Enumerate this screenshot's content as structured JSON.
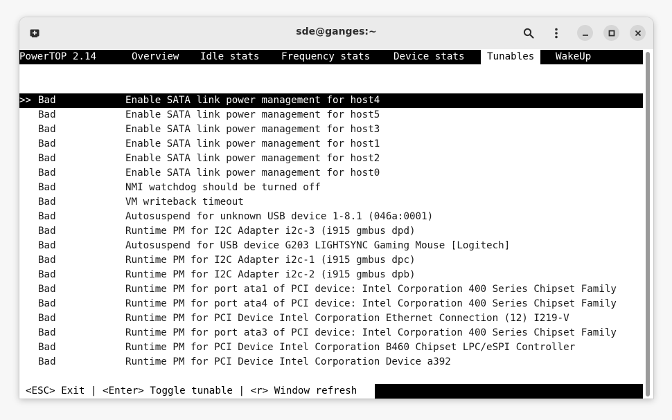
{
  "window": {
    "title": "sde@ganges:~"
  },
  "titlebar_icons": {
    "new_tab": "new-tab-icon",
    "search": "search-icon",
    "menu": "kebab-menu-icon",
    "minimize": "minimize-icon",
    "maximize": "maximize-icon",
    "close": "close-icon"
  },
  "powertop": {
    "app_name": "PowerTOP 2.14",
    "tabs": [
      {
        "label": "Overview"
      },
      {
        "label": "Idle stats"
      },
      {
        "label": "Frequency stats"
      },
      {
        "label": "Device stats"
      },
      {
        "label": "Tunables"
      },
      {
        "label": "WakeUp"
      }
    ],
    "active_tab": "Tunables",
    "selection_marker": ">>",
    "tunables": [
      {
        "status": "Bad",
        "description": "Enable SATA link power management for host4"
      },
      {
        "status": "Bad",
        "description": "Enable SATA link power management for host5"
      },
      {
        "status": "Bad",
        "description": "Enable SATA link power management for host3"
      },
      {
        "status": "Bad",
        "description": "Enable SATA link power management for host1"
      },
      {
        "status": "Bad",
        "description": "Enable SATA link power management for host2"
      },
      {
        "status": "Bad",
        "description": "Enable SATA link power management for host0"
      },
      {
        "status": "Bad",
        "description": "NMI watchdog should be turned off"
      },
      {
        "status": "Bad",
        "description": "VM writeback timeout"
      },
      {
        "status": "Bad",
        "description": "Autosuspend for unknown USB device 1-8.1 (046a:0001)"
      },
      {
        "status": "Bad",
        "description": "Runtime PM for I2C Adapter i2c-3 (i915 gmbus dpd)"
      },
      {
        "status": "Bad",
        "description": "Autosuspend for USB device G203 LIGHTSYNC Gaming Mouse [Logitech]"
      },
      {
        "status": "Bad",
        "description": "Runtime PM for I2C Adapter i2c-1 (i915 gmbus dpc)"
      },
      {
        "status": "Bad",
        "description": "Runtime PM for I2C Adapter i2c-2 (i915 gmbus dpb)"
      },
      {
        "status": "Bad",
        "description": "Runtime PM for port ata1 of PCI device: Intel Corporation 400 Series Chipset Family"
      },
      {
        "status": "Bad",
        "description": "Runtime PM for port ata4 of PCI device: Intel Corporation 400 Series Chipset Family"
      },
      {
        "status": "Bad",
        "description": "Runtime PM for PCI Device Intel Corporation Ethernet Connection (12) I219-V"
      },
      {
        "status": "Bad",
        "description": "Runtime PM for port ata3 of PCI device: Intel Corporation 400 Series Chipset Family"
      },
      {
        "status": "Bad",
        "description": "Runtime PM for PCI Device Intel Corporation B460 Chipset LPC/eSPI Controller"
      },
      {
        "status": "Bad",
        "description": "Runtime PM for PCI Device Intel Corporation Device a392"
      }
    ],
    "status_bar": "<ESC> Exit | <Enter> Toggle tunable | <r> Window refresh"
  },
  "colors": {
    "terminal_bg": "#ffffff",
    "terminal_fg": "#1a1a1a",
    "highlight_bg": "#000000",
    "titlebar_bg": "#ebebeb"
  }
}
